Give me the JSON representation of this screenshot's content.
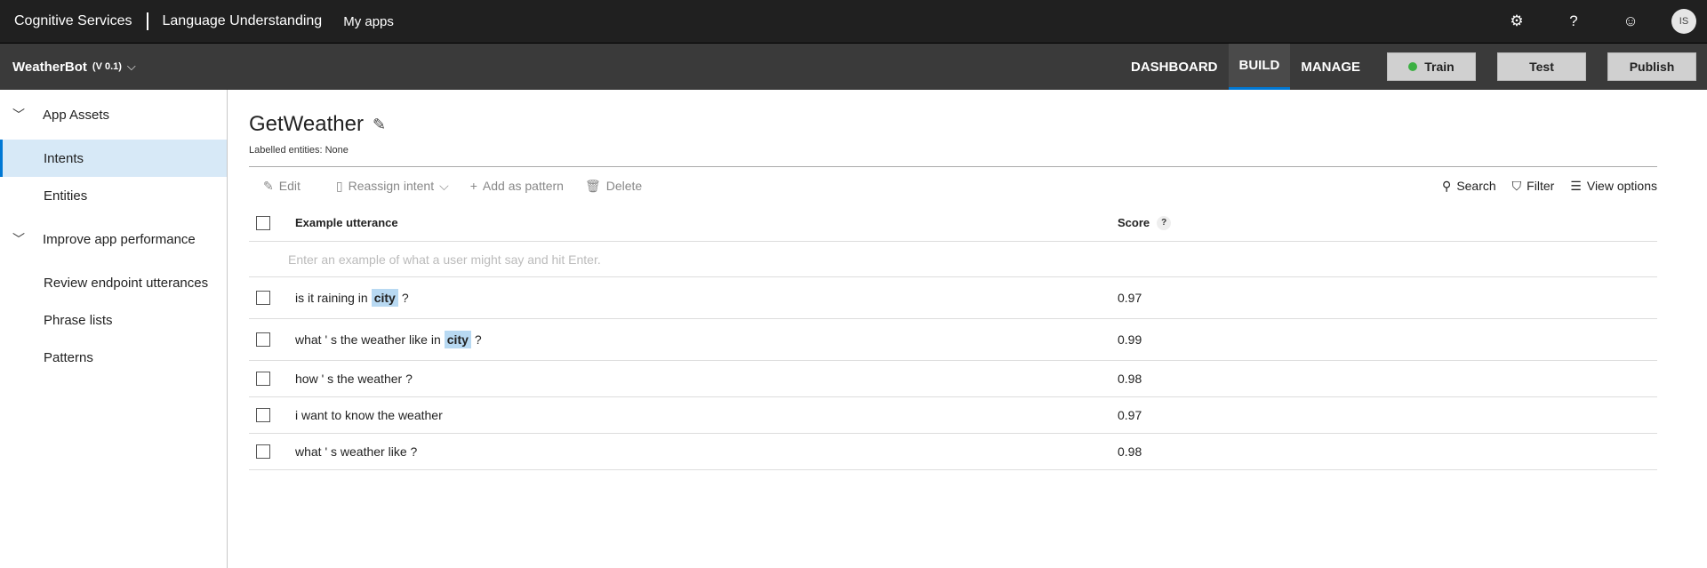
{
  "topbar": {
    "brand": "Cognitive Services",
    "product": "Language Understanding",
    "my_apps": "My apps",
    "icons": [
      "gear-icon",
      "help-icon",
      "smiley-icon"
    ],
    "avatar_initials": "IS"
  },
  "appbar": {
    "app_name": "WeatherBot",
    "version": "(V 0.1)",
    "nav": {
      "dashboard": "DASHBOARD",
      "build": "BUILD",
      "manage": "MANAGE"
    },
    "buttons": {
      "train": "Train",
      "test": "Test",
      "publish": "Publish"
    },
    "active_nav": "BUILD",
    "colors": {
      "train_status": "#3cb043",
      "accent": "#0078d4"
    }
  },
  "sidebar": {
    "sections": [
      {
        "label": "App Assets",
        "items": [
          "Intents",
          "Entities"
        ]
      },
      {
        "label": "Improve app performance",
        "items": [
          "Review endpoint utterances",
          "Phrase lists",
          "Patterns"
        ]
      }
    ],
    "active_item": "Intents"
  },
  "main": {
    "title": "GetWeather",
    "subtitle": "Labelled entities: None",
    "toolbar": {
      "edit": "Edit",
      "reassign": "Reassign intent",
      "add_pattern": "Add as pattern",
      "delete": "Delete",
      "search": "Search",
      "filter": "Filter",
      "view_options": "View options"
    },
    "table": {
      "col_utterance": "Example utterance",
      "col_score": "Score",
      "score_help": "?",
      "input_placeholder": "Enter an example of what a user might say and hit Enter.",
      "rows": [
        {
          "before": "is it raining in",
          "entity": "city",
          "after": "?",
          "score": "0.97"
        },
        {
          "before": "what ' s the weather like in",
          "entity": "city",
          "after": "?",
          "score": "0.99"
        },
        {
          "text": "how ' s the weather ?",
          "score": "0.98"
        },
        {
          "text": "i want to know the weather",
          "score": "0.97"
        },
        {
          "text": "what ' s weather like ?",
          "score": "0.98"
        }
      ]
    }
  }
}
